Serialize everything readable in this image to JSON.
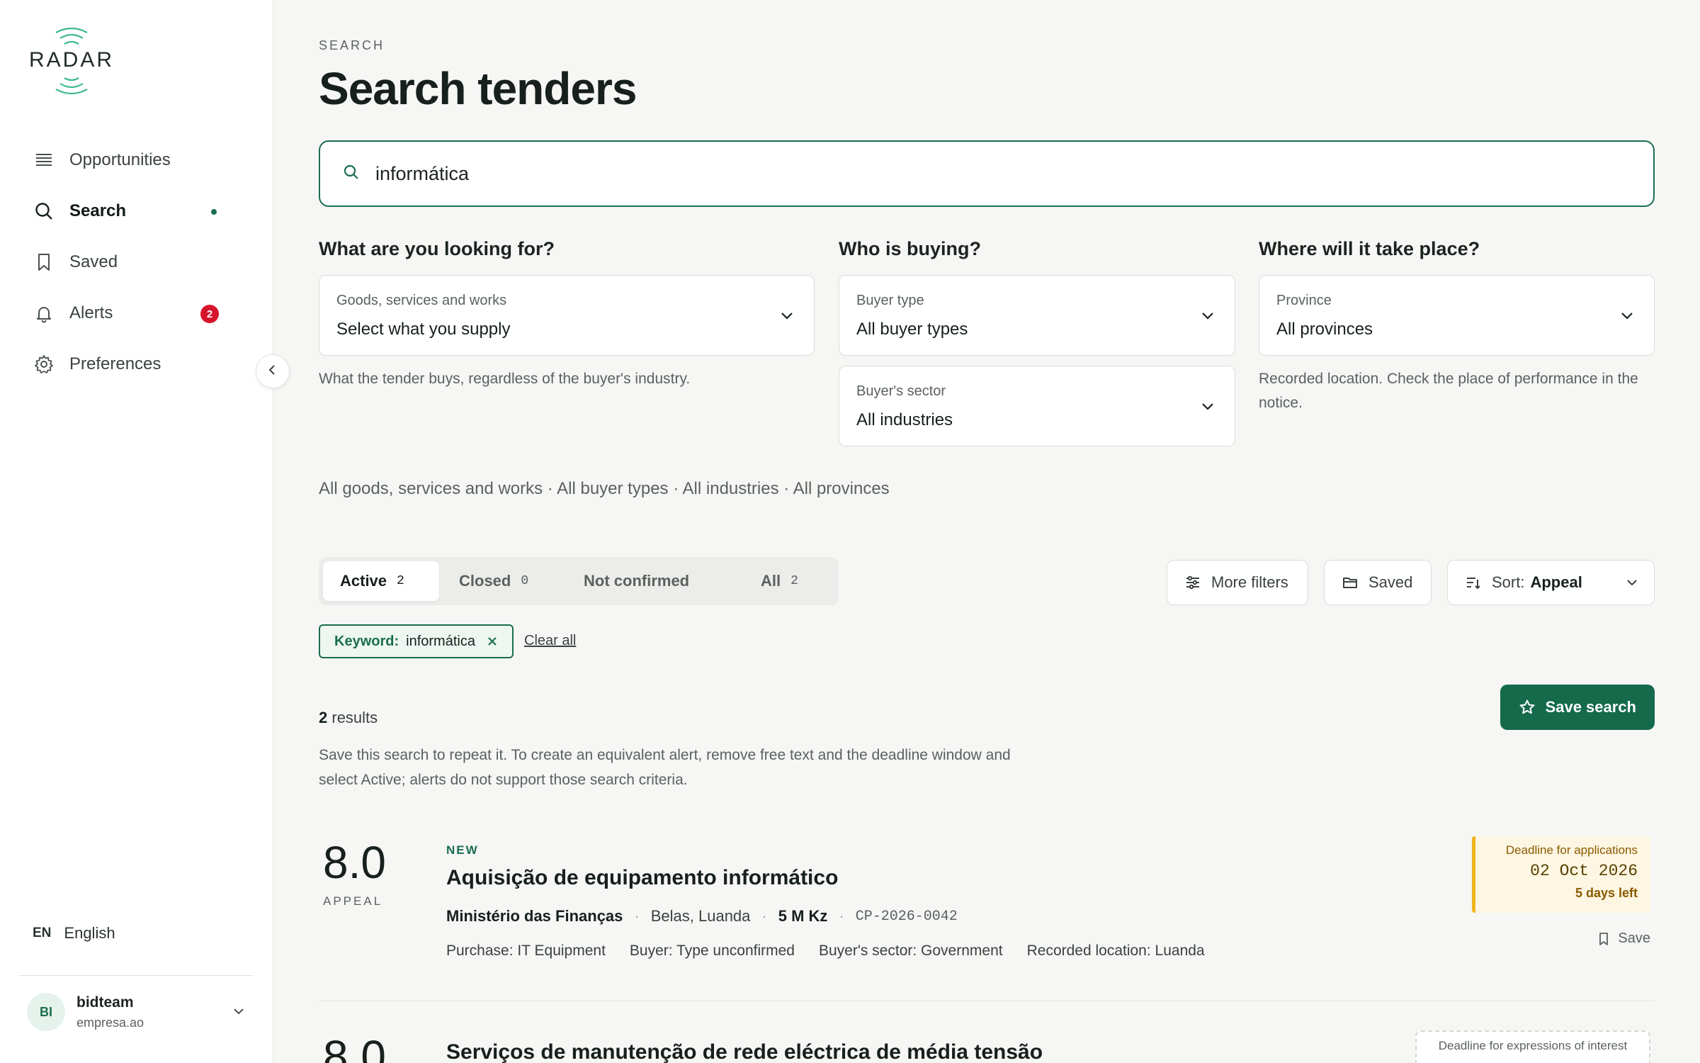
{
  "brand": {
    "name": "RADAR"
  },
  "sidebar": {
    "items": [
      {
        "label": "Opportunities",
        "icon": "list-icon"
      },
      {
        "label": "Search",
        "icon": "search-icon"
      },
      {
        "label": "Saved",
        "icon": "bookmark-icon"
      },
      {
        "label": "Alerts",
        "icon": "bell-icon",
        "badge": "2"
      },
      {
        "label": "Preferences",
        "icon": "gear-icon"
      }
    ],
    "language": {
      "code": "EN",
      "label": "English"
    },
    "user": {
      "initials": "BI",
      "name": "bidteam",
      "org": "empresa.ao"
    }
  },
  "page": {
    "eyebrow": "SEARCH",
    "title": "Search tenders"
  },
  "search": {
    "value": "informática"
  },
  "filters": {
    "what": {
      "title": "What are you looking for?",
      "label": "Goods, services and works",
      "value": "Select what you supply",
      "help": "What the tender buys, regardless of the buyer's industry."
    },
    "who": {
      "title": "Who is buying?",
      "buyer_type": {
        "label": "Buyer type",
        "value": "All buyer types"
      },
      "sector": {
        "label": "Buyer's sector",
        "value": "All industries"
      }
    },
    "where": {
      "title": "Where will it take place?",
      "label": "Province",
      "value": "All provinces",
      "help": "Recorded location. Check the place of performance in the notice."
    },
    "summary": "All goods, services and works · All buyer types · All industries · All provinces"
  },
  "tabs": [
    {
      "label": "Active",
      "count": "2"
    },
    {
      "label": "Closed",
      "count": "0"
    },
    {
      "label": "Not confirmed",
      "count": ""
    },
    {
      "label": "All",
      "count": "2"
    }
  ],
  "toolbar": {
    "more_filters": "More filters",
    "saved": "Saved",
    "sort_label": "Sort:",
    "sort_value": "Appeal"
  },
  "chips": {
    "keyword_key": "Keyword:",
    "keyword_value": "informática",
    "clear_all": "Clear all"
  },
  "results": {
    "count": "2",
    "count_suffix": " results",
    "note": "Save this search to repeat it. To create an equivalent alert, remove free text and the deadline window and select Active; alerts do not support those search criteria.",
    "save_search": "Save search",
    "items": [
      {
        "score": "8.0",
        "score_label": "APPEAL",
        "badge": "NEW",
        "title": "Aquisição de equipamento informático",
        "buyer": "Ministério das Finanças",
        "location": "Belas, Luanda",
        "value": "5 M Kz",
        "ref": "CP-2026-0042",
        "tags": [
          "Purchase: IT Equipment",
          "Buyer: Type unconfirmed",
          "Buyer's sector: Government",
          "Recorded location: Luanda"
        ],
        "deadline_label": "Deadline for applications",
        "deadline_date": "02 Oct 2026",
        "days_left": "5 days left",
        "save": "Save"
      },
      {
        "score": "8.0",
        "title": "Serviços de manutenção de rede eléctrica de média tensão",
        "deadline_label": "Deadline for expressions of interest"
      }
    ]
  },
  "colors": {
    "accent": "#1a6e4f",
    "badge": "#d6142b",
    "deadline": "#f0b420"
  }
}
